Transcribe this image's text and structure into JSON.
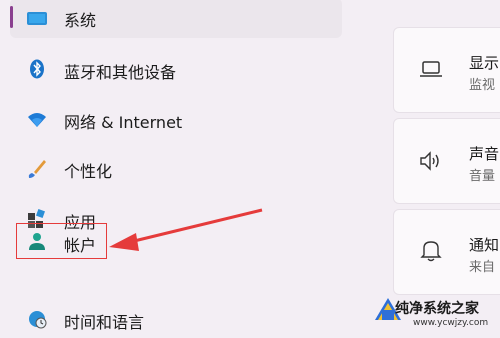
{
  "sidebar": {
    "items": [
      {
        "label": "系统",
        "icon": "monitor-icon",
        "selected": true
      },
      {
        "label": "蓝牙和其他设备",
        "icon": "bluetooth-icon"
      },
      {
        "label": "网络 & Internet",
        "icon": "wifi-icon"
      },
      {
        "label": "个性化",
        "icon": "paintbrush-icon"
      },
      {
        "label": "应用",
        "icon": "apps-icon"
      },
      {
        "label": "帐户",
        "icon": "person-icon"
      },
      {
        "label": "时间和语言",
        "icon": "globe-clock-icon"
      }
    ]
  },
  "cards": [
    {
      "title": "显示",
      "subtitle": "监视",
      "icon": "laptop-icon"
    },
    {
      "title": "声音",
      "subtitle": "音量",
      "icon": "speaker-icon"
    },
    {
      "title": "通知",
      "subtitle": "来自",
      "icon": "bell-icon"
    }
  ],
  "watermark": {
    "line1": "纯净系统之家",
    "line2": "www.ycwjzy.com"
  },
  "colors": {
    "accent": "#8a3f8f",
    "annotation": "#e53b3b",
    "background": "#f3eef4"
  }
}
